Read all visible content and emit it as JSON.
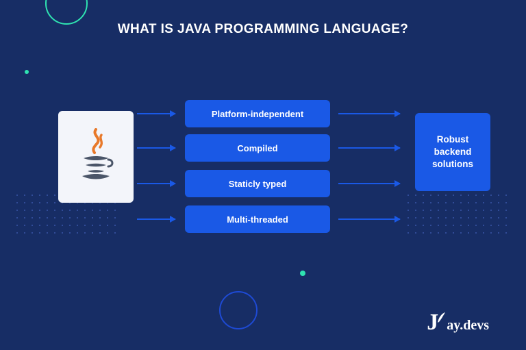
{
  "title": "WHAT IS JAVA PROGRAMMING LANGUAGE?",
  "source": {
    "name": "Java",
    "icon": "java-logo-icon"
  },
  "features": [
    "Platform-independent",
    "Compiled",
    "Staticly typed",
    "Multi-threaded"
  ],
  "result": "Robust backend solutions",
  "brand": {
    "label": "Jay.devs"
  },
  "colors": {
    "bg": "#172d65",
    "accent": "#1a59e6",
    "mint": "#2fe3b1",
    "card": "#f3f5fa"
  }
}
